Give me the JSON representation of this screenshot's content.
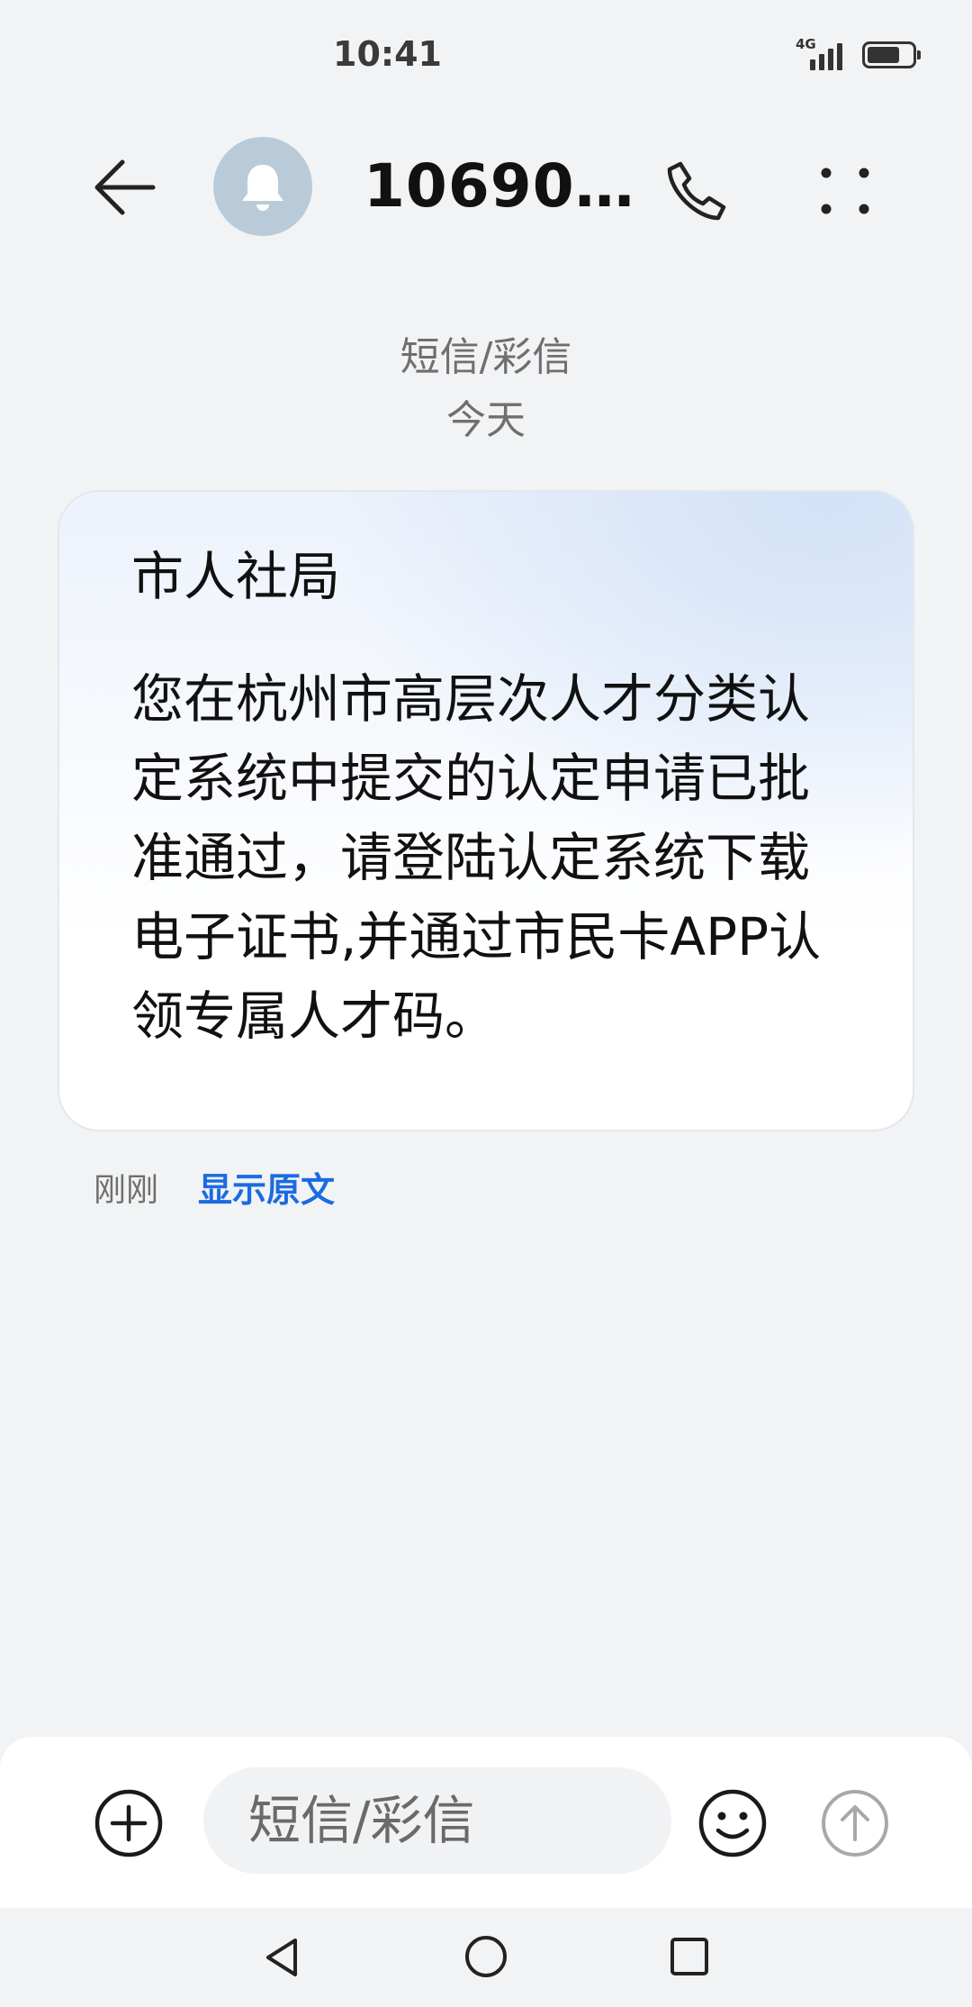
{
  "status_bar": {
    "time": "10:41",
    "network": "4G",
    "battery_level": 0.75
  },
  "header": {
    "contact_name": "10690…",
    "icons": {
      "back": "back-arrow-icon",
      "avatar": "bell-icon",
      "call": "phone-icon",
      "more": "more-dots-icon"
    }
  },
  "conversation": {
    "type_label": "短信/彩信",
    "date_label": "今天",
    "message": {
      "sender": "市人社局",
      "body": "您在杭州市高层次人才分类认定系统中提交的认定申请已批准通过，请登陆认定系统下载电子证书,并通过市民卡APP认领专属人才码。",
      "time": "刚刚",
      "show_original": "显示原文"
    }
  },
  "composer": {
    "placeholder": "短信/彩信",
    "icons": {
      "attach": "plus-circle-icon",
      "emoji": "smiley-icon",
      "send": "send-arrow-icon"
    }
  },
  "colors": {
    "background": "#f1f3f5",
    "accent": "#1c6be0",
    "avatar": "#b9cbd8"
  }
}
